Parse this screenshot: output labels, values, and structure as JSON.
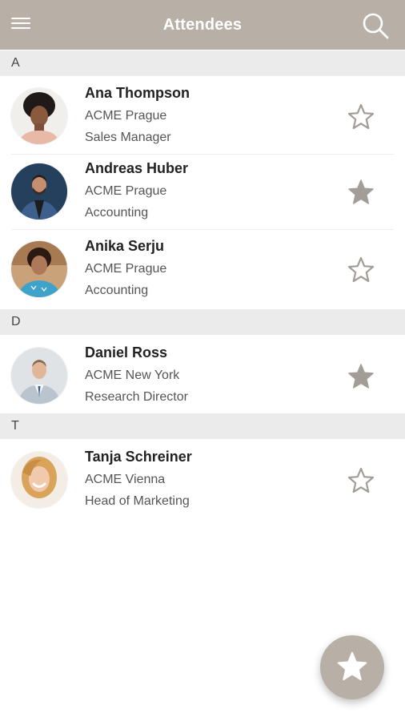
{
  "app_bar": {
    "title": "Attendees",
    "background": "#b8b0a6",
    "menu_icon": "hamburger-menu-icon",
    "search_icon": "search-icon"
  },
  "sections": [
    {
      "letter": "A",
      "attendees": [
        {
          "name": "Ana Thompson",
          "company": "ACME Prague",
          "role": "Sales Manager",
          "favorite": false
        },
        {
          "name": "Andreas Huber",
          "company": "ACME Prague",
          "role": "Accounting",
          "favorite": true
        },
        {
          "name": "Anika Serju",
          "company": "ACME Prague",
          "role": "Accounting",
          "favorite": false
        }
      ]
    },
    {
      "letter": "D",
      "attendees": [
        {
          "name": "Daniel Ross",
          "company": "ACME New York",
          "role": "Research Director",
          "favorite": true
        }
      ]
    },
    {
      "letter": "T",
      "attendees": [
        {
          "name": "Tanja Schreiner",
          "company": "ACME Vienna",
          "role": "Head of Marketing",
          "favorite": false
        }
      ]
    }
  ],
  "fab": {
    "icon": "star-icon",
    "color": "#b8b0a6"
  }
}
